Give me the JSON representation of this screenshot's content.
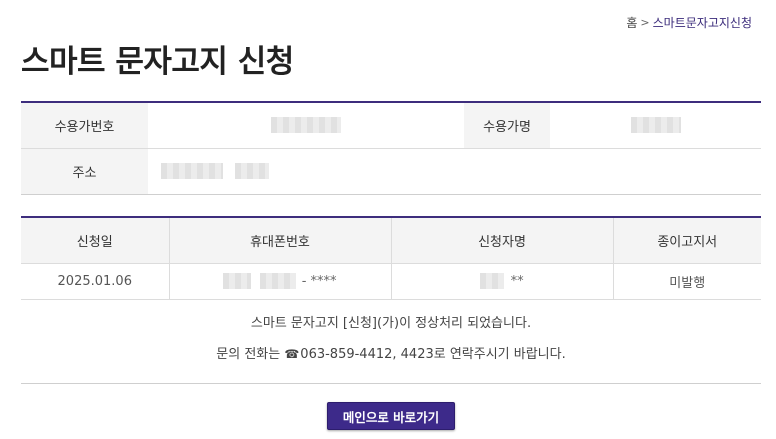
{
  "breadcrumb": {
    "home": "홈",
    "separator": ">",
    "current": "스마트문자고지신청"
  },
  "page_title": "스마트 문자고지 신청",
  "info": {
    "customer_number_label": "수용가번호",
    "customer_name_label": "수용가명",
    "address_label": "주소"
  },
  "result": {
    "headers": [
      "신청일",
      "휴대폰번호",
      "신청자명",
      "종이고지서"
    ],
    "row": {
      "date": "2025.01.06",
      "phone_suffix": "- ****",
      "name_suffix": "**",
      "paper_bill": "미발행"
    }
  },
  "messages": {
    "line1": "스마트 문자고지 [신청](가)이 정상처리 되었습니다.",
    "line2_prefix": "문의 전화는 ",
    "phone_icon": "☎",
    "line2_rest": "063-859-4412, 4423로 연락주시기 바랍니다."
  },
  "main_button_label": "메인으로 바로가기",
  "colors": {
    "accent": "#3d2d7d",
    "button": "#3d2a8a"
  }
}
